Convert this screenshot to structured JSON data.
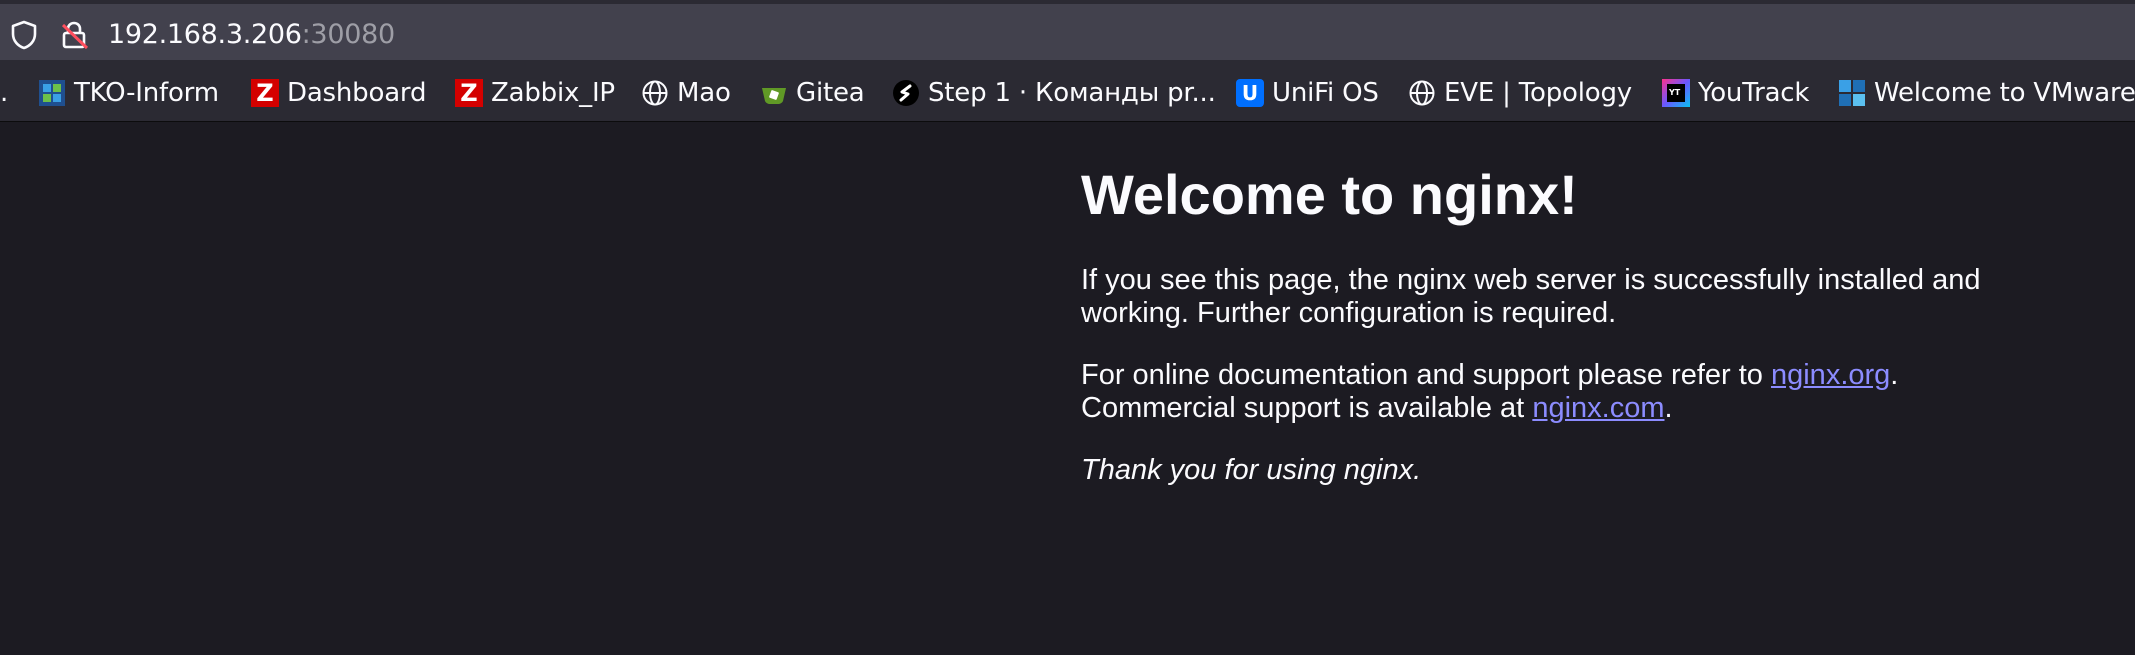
{
  "address_bar": {
    "host": "192.168.3.206",
    "port": ":30080"
  },
  "bookmarks": [
    {
      "leading": "."
    },
    {
      "label": "TKO-Inform",
      "icon": "tko-inform-icon"
    },
    {
      "label": "Dashboard",
      "icon": "zabbix-icon",
      "icon_letter": "Z"
    },
    {
      "label": "Zabbix_IP",
      "icon": "zabbix-icon",
      "icon_letter": "Z"
    },
    {
      "label": "Mao",
      "icon": "globe-icon"
    },
    {
      "label": "Gitea",
      "icon": "gitea-icon"
    },
    {
      "label": "Step 1 · Команды pr...",
      "icon": "step-icon"
    },
    {
      "label": "UniFi OS",
      "icon": "unifi-icon",
      "icon_letter": "U"
    },
    {
      "label": "EVE | Topology",
      "icon": "globe-icon"
    },
    {
      "label": "YouTrack",
      "icon": "youtrack-icon",
      "icon_letter": "YT"
    },
    {
      "label": "Welcome to VMware...",
      "icon": "vmware-icon"
    }
  ],
  "page": {
    "title": "Welcome to nginx!",
    "p1_line1": "If you see this page, the nginx web server is successfully installed and",
    "p1_line2": "working. Further configuration is required.",
    "p2_text1": "For online documentation and support please refer to ",
    "p2_link1": "nginx.org",
    "p2_text2": ".",
    "p2_text3": "Commercial support is available at ",
    "p2_link2": "nginx.com",
    "p2_text4": ".",
    "p3": "Thank you for using nginx."
  },
  "colors": {
    "page_background": "#1c1b22",
    "toolbar": "#2b2a33",
    "urlbar": "#42414d",
    "link": "#8c8cff",
    "text": "#fbfbfe"
  }
}
